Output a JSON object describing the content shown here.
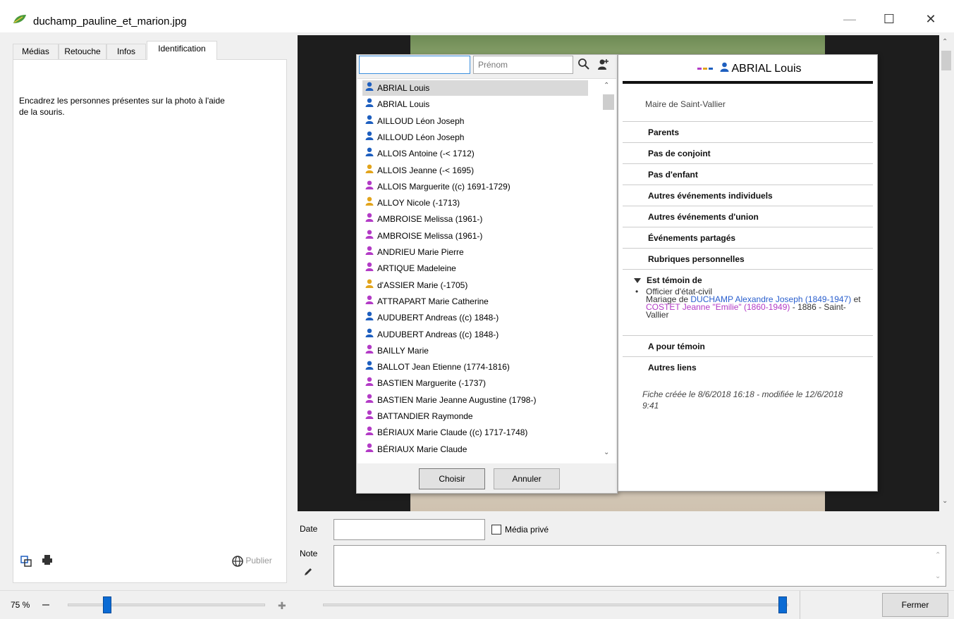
{
  "window": {
    "title": "duchamp_pauline_et_marion.jpg",
    "minimize": "—",
    "maximize": "☐",
    "close": "✕"
  },
  "left_panel": {
    "tabs": [
      "Médias",
      "Retouche",
      "Infos",
      "Identification"
    ],
    "active_tab": "Identification",
    "instructions": "Encadrez les personnes présentes sur la photo à l'aide de la souris.",
    "publish_label": "Publier"
  },
  "picker": {
    "name_value": "",
    "prenom_placeholder": "Prénom",
    "items": [
      {
        "label": "ABRIAL Louis",
        "sex": "m",
        "selected": true
      },
      {
        "label": "ABRIAL Louis",
        "sex": "m"
      },
      {
        "label": "AILLOUD Léon Joseph",
        "sex": "m"
      },
      {
        "label": "AILLOUD Léon Joseph",
        "sex": "m"
      },
      {
        "label": "ALLOIS Antoine (-< 1712)",
        "sex": "m"
      },
      {
        "label": "ALLOIS Jeanne (-< 1695)",
        "sex": "u"
      },
      {
        "label": "ALLOIS Marguerite ((c) 1691-1729)",
        "sex": "f"
      },
      {
        "label": "ALLOY Nicole (-1713)",
        "sex": "u"
      },
      {
        "label": "AMBROISE Melissa (1961-)",
        "sex": "f"
      },
      {
        "label": "AMBROISE Melissa (1961-)",
        "sex": "f"
      },
      {
        "label": "ANDRIEU Marie Pierre",
        "sex": "f"
      },
      {
        "label": "ARTIQUE Madeleine",
        "sex": "f"
      },
      {
        "label": "d'ASSIER Marie (-1705)",
        "sex": "u"
      },
      {
        "label": "ATTRAPART Marie Catherine",
        "sex": "f"
      },
      {
        "label": "AUDUBERT Andreas ((c) 1848-)",
        "sex": "m"
      },
      {
        "label": "AUDUBERT Andreas ((c) 1848-)",
        "sex": "m"
      },
      {
        "label": "BAILLY Marie",
        "sex": "f"
      },
      {
        "label": "BALLOT Jean Etienne (1774-1816)",
        "sex": "m"
      },
      {
        "label": "BASTIEN Marguerite (-1737)",
        "sex": "f"
      },
      {
        "label": "BASTIEN Marie Jeanne Augustine (1798-)",
        "sex": "f"
      },
      {
        "label": "BATTANDIER Raymonde",
        "sex": "f"
      },
      {
        "label": "BÉRIAUX Marie Claude ((c) 1717-1748)",
        "sex": "f"
      },
      {
        "label": "BÉRIAUX Marie Claude",
        "sex": "f"
      }
    ],
    "choose_label": "Choisir",
    "cancel_label": "Annuler"
  },
  "detail": {
    "name": "ABRIAL Louis",
    "subtitle": "Maire de Saint-Vallier",
    "sections": [
      "Parents",
      "Pas de conjoint",
      "Pas d'enfant",
      "Autres événements individuels",
      "Autres événements d'union",
      "Événements partagés",
      "Rubriques personnelles"
    ],
    "temoin_title": "Est témoin de",
    "temoin_bullet": "•",
    "temoin_role": "Officier d'état-civil",
    "temoin_prefix": "Mariage de ",
    "temoin_husband": "DUCHAMP Alexandre Joseph (1849-1947)",
    "temoin_and": " et ",
    "temoin_wife": "COSTET Jeanne \"Emilie\" (1860-1949)",
    "temoin_suffix": " - 1886 - Saint-Vallier",
    "pour_temoin": "A pour témoin",
    "autres_liens": "Autres liens",
    "footnote": "Fiche créée le 8/6/2018 16:18 - modifiée le 12/6/2018 9:41",
    "colors": {
      "male": "#1e5fbf",
      "female": "#b33bc6",
      "unknown": "#e2a41c"
    }
  },
  "form": {
    "date_label": "Date",
    "date_value": "",
    "private_label": "Média privé",
    "note_label": "Note",
    "note_value": ""
  },
  "bottom": {
    "zoom": "75 %",
    "zoom_fraction": 0.18,
    "close_label": "Fermer"
  }
}
